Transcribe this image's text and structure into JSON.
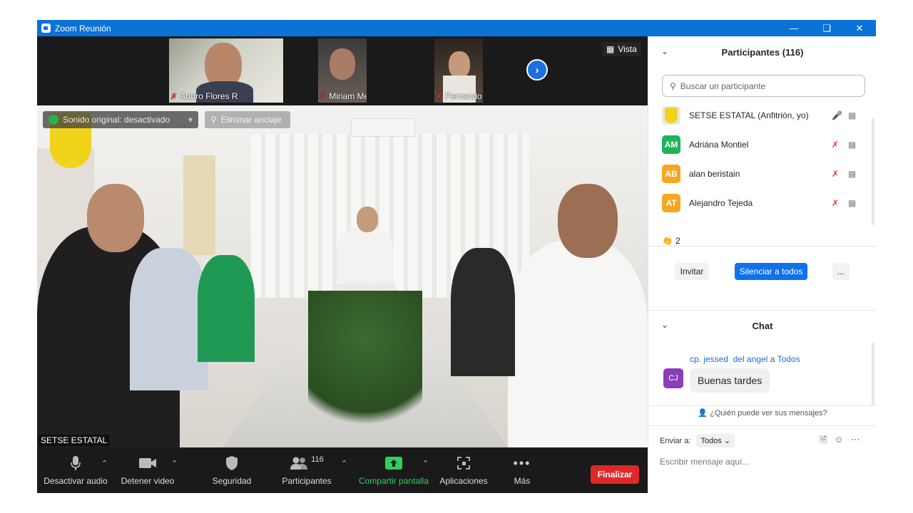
{
  "window": {
    "title": "Zoom Reunión"
  },
  "thumbnails": [
    {
      "name": "Arturo Flores R"
    },
    {
      "name": "Miriam Meza"
    },
    {
      "name": "Fernando Benítez"
    }
  ],
  "vista_label": "Vista",
  "overlay": {
    "original_sound": "Sonido original: desactivado",
    "remove_pin": "Eliminar anclaje"
  },
  "speaker_name": "SETSE ESTATAL",
  "toolbar": {
    "mute": "Desactivar audio",
    "video": "Detener video",
    "security": "Seguridad",
    "participants": "Participantes",
    "participants_count": "116",
    "share": "Compartir pantalla",
    "apps": "Aplicaciones",
    "more": "Más",
    "end": "Finalizar"
  },
  "participants_panel": {
    "title": "Participantes (116)",
    "search_placeholder": "Buscar un participante",
    "items": [
      {
        "name": "SETSE ESTATAL (Anfitrión, yo)",
        "initials": "",
        "color": "#e8e8e8",
        "mic": "on"
      },
      {
        "name": "Adriána Montiel",
        "initials": "AM",
        "color": "#1fb35c",
        "mic": "off"
      },
      {
        "name": "alan beristain",
        "initials": "AB",
        "color": "#f5a623",
        "mic": "off"
      },
      {
        "name": "Alejandro Tejeda",
        "initials": "AT",
        "color": "#f5a623",
        "mic": "off"
      }
    ],
    "reaction_count": "2",
    "invite": "Invitar",
    "mute_all": "Silenciar a todos",
    "more": "..."
  },
  "chat": {
    "title": "Chat",
    "sender": "cp. jessed  del angel",
    "to_word": "a",
    "recipient": "Todos",
    "sender_initials": "CJ",
    "message": "Buenas tardes",
    "who_sees": "¿Quién puede ver sus mensajes?",
    "send_to_label": "Enviar a:",
    "send_to_value": "Todos",
    "input_placeholder": "Escribir mensaje aquí..."
  },
  "colors": {
    "titlebar": "#0b72d8",
    "accent": "#1b6fe0",
    "end": "#e02828",
    "share": "#2ed15c"
  }
}
